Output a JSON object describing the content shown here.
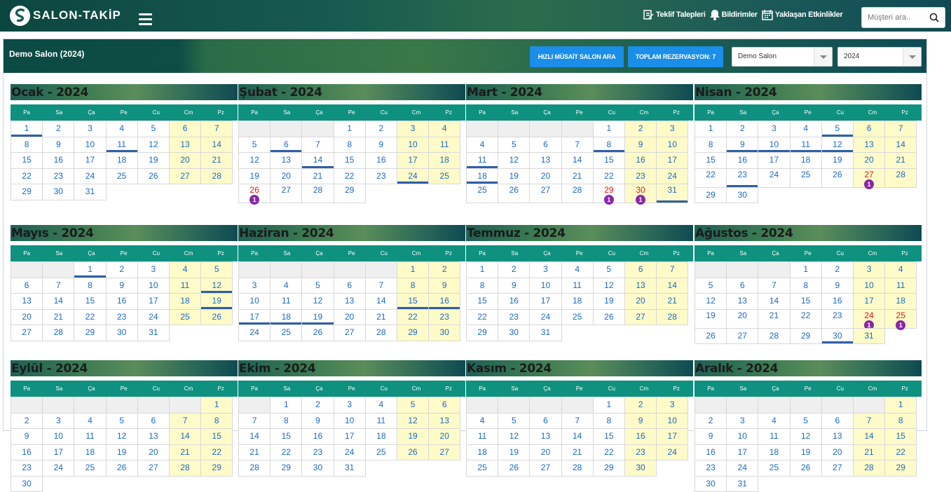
{
  "brand": {
    "name": "SALON-TAKİP",
    "logo_icon": "s-logo-icon"
  },
  "topbar": {
    "links": [
      {
        "label": "Teklif Talepleri",
        "icon": "edit-icon"
      },
      {
        "label": "Bildirimler",
        "icon": "bell-icon"
      },
      {
        "label": "Yaklaşan Etkinlikler",
        "icon": "calendar-icon"
      }
    ],
    "search_placeholder": "Müşteri ara.."
  },
  "header": {
    "title": "Demo Salon (2024)",
    "find_button": "HIZLI MÜSAİT SALON ARA",
    "total_button": "TOPLAM REZERVASYON: 7",
    "salon_select": "Demo Salon",
    "year_select": "2024"
  },
  "colors": {
    "accent_blue": "#1a8ee8",
    "day_header": "#0f9180",
    "weekend": "#fffbc8",
    "reserved": "#e01616",
    "badge": "#8a27a8",
    "day_text": "#1969c6"
  },
  "weekdays": [
    "Pa",
    "Sa",
    "Ça",
    "Pe",
    "Cu",
    "Cm",
    "Pz"
  ],
  "months": [
    {
      "name": "Ocak - 2024",
      "offset": 0,
      "days": 31,
      "underline": [
        1,
        11
      ],
      "reserved": {}
    },
    {
      "name": "Şubat - 2024",
      "offset": 3,
      "days": 29,
      "underline": [
        6,
        14,
        24
      ],
      "reserved": {
        "26": "1"
      }
    },
    {
      "name": "Mart - 2024",
      "offset": 4,
      "days": 31,
      "underline": [
        8,
        11,
        18,
        31
      ],
      "reserved": {
        "29": "1",
        "30": "1"
      }
    },
    {
      "name": "Nisan - 2024",
      "offset": 0,
      "days": 30,
      "underline": [
        5,
        9,
        10,
        11,
        12,
        23
      ],
      "reserved": {
        "27": "1"
      }
    },
    {
      "name": "Mayıs - 2024",
      "offset": 2,
      "days": 31,
      "underline": [
        1,
        12,
        19
      ],
      "reserved": {}
    },
    {
      "name": "Haziran - 2024",
      "offset": 5,
      "days": 30,
      "underline": [
        15,
        16,
        17,
        18,
        19
      ],
      "reserved": {}
    },
    {
      "name": "Temmuz - 2024",
      "offset": 0,
      "days": 31,
      "underline": [],
      "reserved": {}
    },
    {
      "name": "Ağustos - 2024",
      "offset": 3,
      "days": 31,
      "underline": [
        30
      ],
      "reserved": {
        "24": "1",
        "25": "1"
      }
    },
    {
      "name": "Eylül - 2024",
      "offset": 6,
      "days": 30,
      "underline": [],
      "reserved": {}
    },
    {
      "name": "Ekim - 2024",
      "offset": 1,
      "days": 31,
      "underline": [],
      "reserved": {}
    },
    {
      "name": "Kasım - 2024",
      "offset": 4,
      "days": 30,
      "underline": [],
      "reserved": {}
    },
    {
      "name": "Aralık - 2024",
      "offset": 6,
      "days": 31,
      "underline": [],
      "reserved": {}
    }
  ]
}
